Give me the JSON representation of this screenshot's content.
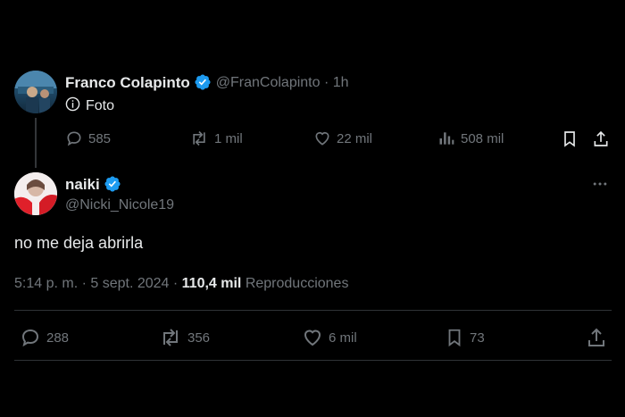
{
  "parent_tweet": {
    "display_name": "Franco Colapinto",
    "handle_time": "@FranColapinto · 1h",
    "body": "Foto",
    "stats": {
      "replies": "585",
      "reposts": "1 mil",
      "likes": "22 mil",
      "views": "508 mil"
    },
    "icons": [
      "info-icon",
      "reply-icon",
      "repost-icon",
      "like-icon",
      "views-icon",
      "bookmark-icon",
      "share-icon",
      "verified-icon",
      "more-icon"
    ]
  },
  "reply_tweet": {
    "display_name": "naiki",
    "handle": "@Nicki_Nicole19",
    "body": "no me deja abrirla",
    "meta": {
      "timestamp": "5:14 p. m. · 5 sept. 2024 · ",
      "views_count": "110,4 mil",
      "views_label": " Reproducciones"
    },
    "stats": {
      "replies": "288",
      "reposts": "356",
      "likes": "6 mil",
      "bookmarks": "73"
    }
  },
  "colors": {
    "background": "#000000",
    "text": "#e7e9ea",
    "muted": "#71767b",
    "verified": "#1d9bf0",
    "divider": "#2f3336"
  }
}
